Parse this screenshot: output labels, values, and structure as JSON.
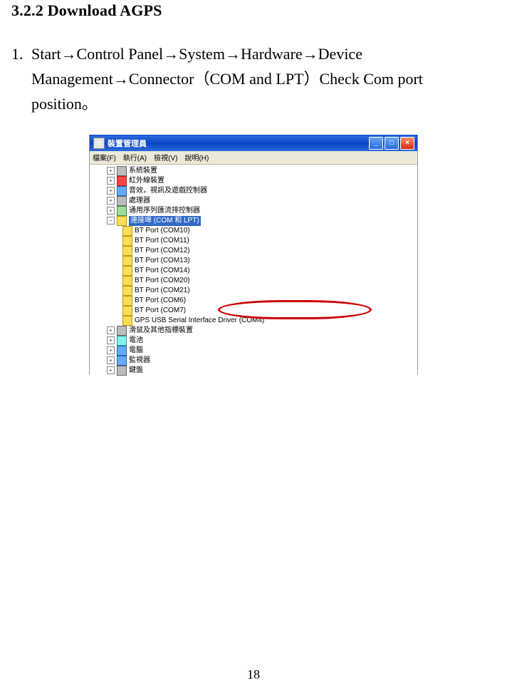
{
  "section_heading": "3.2.2  Download AGPS",
  "step": {
    "number": "1.",
    "text": "Start→Control Panel→System→Hardware→Device Management→Connector（COM and LPT）Check Com port position。"
  },
  "window": {
    "title": "裝置管理員",
    "menu": {
      "file": "檔案(F)",
      "action": "執行(A)",
      "view": "檢視(V)",
      "help": "說明(H)"
    },
    "tree": {
      "root_items": [
        "系統裝置",
        "紅外線裝置",
        "音效，視訊及遊戲控制器",
        "處理器",
        "通用序列匯流排控制器"
      ],
      "ports_selected": "連接埠 (COM 和 LPT)",
      "ports_children": [
        "BT Port (COM10)",
        "BT Port (COM11)",
        "BT Port (COM12)",
        "BT Port (COM13)",
        "BT Port (COM14)",
        "BT Port (COM20)",
        "BT Port (COM21)",
        "BT Port (COM6)",
        "BT Port (COM7)",
        "GPS USB Serial Interface Driver (COM4)"
      ],
      "after_items": [
        "滑鼠及其他指標裝置",
        "電池",
        "電腦",
        "監視器",
        "鍵盤"
      ]
    }
  },
  "page_number": "18"
}
